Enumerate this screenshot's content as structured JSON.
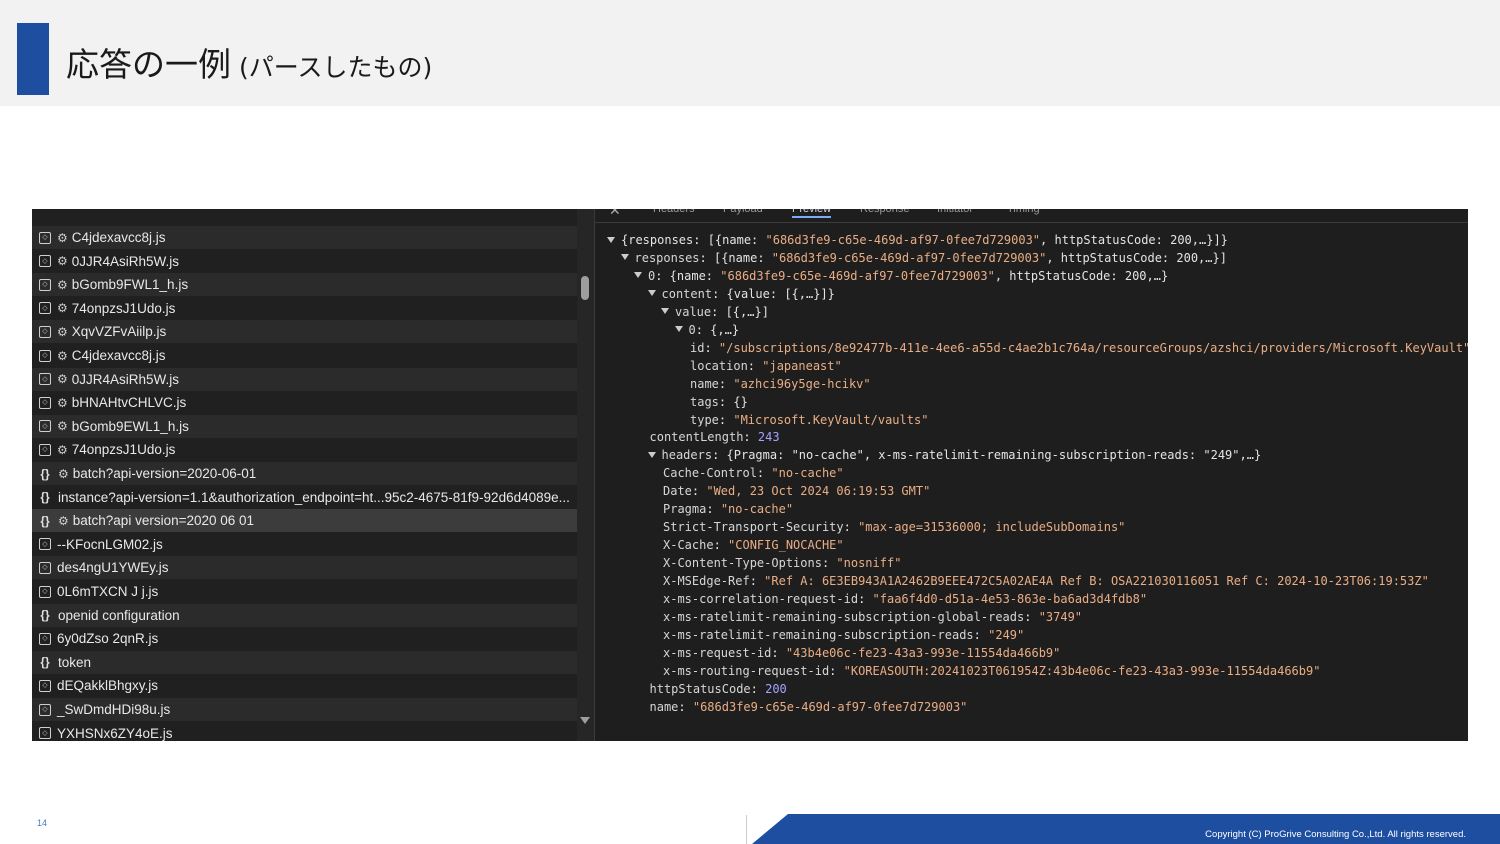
{
  "slide": {
    "title_main": "応答の一例",
    "title_sub": " (パースしたもの)",
    "page_number": "14",
    "copyright": "Copyright (C) ProGrive Consulting Co.,Ltd. All rights reserved."
  },
  "file_list": {
    "items": [
      {
        "name": "C4jdexavcc8j.js",
        "icon": "file-icon",
        "gear": true
      },
      {
        "name": "0JJR4AsiRh5W.js",
        "icon": "file-icon",
        "gear": true
      },
      {
        "name": "bGomb9FWL1_h.js",
        "icon": "file-icon",
        "gear": true
      },
      {
        "name": "74onpzsJ1Udo.js",
        "icon": "file-icon",
        "gear": true
      },
      {
        "name": "XqvVZFvAiilp.js",
        "icon": "file-icon",
        "gear": true
      },
      {
        "name": "C4jdexavcc8j.js",
        "icon": "file-icon",
        "gear": true
      },
      {
        "name": "0JJR4AsiRh5W.js",
        "icon": "file-icon",
        "gear": true
      },
      {
        "name": "bHNAHtvCHLVC.js",
        "icon": "file-icon",
        "gear": true
      },
      {
        "name": "bGomb9EWL1_h.js",
        "icon": "file-icon",
        "gear": true
      },
      {
        "name": "74onpzsJ1Udo.js",
        "icon": "file-icon",
        "gear": true
      },
      {
        "name": "batch?api-version=2020-06-01",
        "icon": "braces-icon",
        "gear": true
      },
      {
        "name": "instance?api-version=1.1&authorization_endpoint=ht...95c2-4675-81f9-92d6d4089e...",
        "icon": "braces-icon",
        "gear": false
      },
      {
        "name": "batch?api version=2020 06 01",
        "icon": "braces-icon",
        "gear": true,
        "selected": true
      },
      {
        "name": "--KFocnLGM02.js",
        "icon": "file-icon",
        "gear": false
      },
      {
        "name": "des4ngU1YWEy.js",
        "icon": "file-icon",
        "gear": false
      },
      {
        "name": "0L6mTXCN J j.js",
        "icon": "file-icon",
        "gear": false
      },
      {
        "name": "openid configuration",
        "icon": "braces-icon",
        "gear": false
      },
      {
        "name": "6y0dZso 2qnR.js",
        "icon": "file-icon",
        "gear": false
      },
      {
        "name": "token",
        "icon": "braces-icon",
        "gear": false
      },
      {
        "name": "dEQakklBhgxy.js",
        "icon": "file-icon",
        "gear": false
      },
      {
        "name": "_SwDmdHDi98u.js",
        "icon": "file-icon",
        "gear": false
      },
      {
        "name": "YXHSNx6ZY4oE.js",
        "icon": "file-icon",
        "gear": false
      }
    ]
  },
  "preview": {
    "tabs": [
      "Headers",
      "Payload",
      "Preview",
      "Response",
      "Initiator",
      "Timing"
    ],
    "active_tab": "Preview",
    "lines": [
      {
        "indent": 0,
        "tri": true,
        "parts": [
          [
            "p",
            "{responses: [{name: "
          ],
          [
            "s",
            "\"686d3fe9-c65e-469d-af97-0fee7d729003\""
          ],
          [
            "p",
            ", httpStatusCode: 200,…}]}"
          ]
        ]
      },
      {
        "indent": 1,
        "tri": true,
        "parts": [
          [
            "k",
            "responses"
          ],
          [
            "p",
            ": [{name: "
          ],
          [
            "s",
            "\"686d3fe9-c65e-469d-af97-0fee7d729003\""
          ],
          [
            "p",
            ", httpStatusCode: 200,…}]"
          ]
        ]
      },
      {
        "indent": 2,
        "tri": true,
        "parts": [
          [
            "k",
            "0"
          ],
          [
            "p",
            ": {name: "
          ],
          [
            "s",
            "\"686d3fe9-c65e-469d-af97-0fee7d729003\""
          ],
          [
            "p",
            ", httpStatusCode: 200,…}"
          ]
        ]
      },
      {
        "indent": 3,
        "tri": true,
        "parts": [
          [
            "k",
            "content"
          ],
          [
            "p",
            ": {value: [{,…}]}"
          ]
        ]
      },
      {
        "indent": 4,
        "tri": true,
        "parts": [
          [
            "k",
            "value"
          ],
          [
            "p",
            ": [{,…}]"
          ]
        ]
      },
      {
        "indent": 5,
        "tri": true,
        "parts": [
          [
            "k",
            "0"
          ],
          [
            "p",
            ": {,…}"
          ]
        ]
      },
      {
        "indent": 6,
        "tri": false,
        "parts": [
          [
            "k",
            "id"
          ],
          [
            "p",
            ": "
          ],
          [
            "s",
            "\"/subscriptions/8e92477b-411e-4ee6-a55d-c4ae2b1c764a/resourceGroups/azshci/providers/Microsoft.KeyVault\""
          ]
        ]
      },
      {
        "indent": 6,
        "tri": false,
        "parts": [
          [
            "k",
            "location"
          ],
          [
            "p",
            ": "
          ],
          [
            "s",
            "\"japaneast\""
          ]
        ]
      },
      {
        "indent": 6,
        "tri": false,
        "parts": [
          [
            "k",
            "name"
          ],
          [
            "p",
            ": "
          ],
          [
            "s",
            "\"azhci96y5ge-hcikv\""
          ]
        ]
      },
      {
        "indent": 6,
        "tri": false,
        "parts": [
          [
            "k",
            "tags"
          ],
          [
            "p",
            ": {}"
          ]
        ]
      },
      {
        "indent": 6,
        "tri": false,
        "parts": [
          [
            "k",
            "type"
          ],
          [
            "p",
            ": "
          ],
          [
            "s",
            "\"Microsoft.KeyVault/vaults\""
          ]
        ]
      },
      {
        "indent": 3,
        "tri": false,
        "parts": [
          [
            "k",
            "contentLength"
          ],
          [
            "p",
            ": "
          ],
          [
            "n",
            "243"
          ]
        ]
      },
      {
        "indent": 3,
        "tri": true,
        "parts": [
          [
            "k",
            "headers"
          ],
          [
            "p",
            ": {Pragma: "
          ],
          [
            "p",
            "\"no-cache\""
          ],
          [
            "p",
            ", x-ms-ratelimit-remaining-subscription-reads: "
          ],
          [
            "p",
            "\"249\""
          ],
          [
            "p",
            ",…}"
          ]
        ]
      },
      {
        "indent": 4,
        "tri": false,
        "parts": [
          [
            "k",
            "Cache-Control"
          ],
          [
            "p",
            ": "
          ],
          [
            "s",
            "\"no-cache\""
          ]
        ]
      },
      {
        "indent": 4,
        "tri": false,
        "parts": [
          [
            "k",
            "Date"
          ],
          [
            "p",
            ": "
          ],
          [
            "s",
            "\"Wed, 23 Oct 2024 06:19:53 GMT\""
          ]
        ]
      },
      {
        "indent": 4,
        "tri": false,
        "parts": [
          [
            "k",
            "Pragma"
          ],
          [
            "p",
            ": "
          ],
          [
            "s",
            "\"no-cache\""
          ]
        ]
      },
      {
        "indent": 4,
        "tri": false,
        "parts": [
          [
            "k",
            "Strict-Transport-Security"
          ],
          [
            "p",
            ": "
          ],
          [
            "s",
            "\"max-age=31536000; includeSubDomains\""
          ]
        ]
      },
      {
        "indent": 4,
        "tri": false,
        "parts": [
          [
            "k",
            "X-Cache"
          ],
          [
            "p",
            ": "
          ],
          [
            "s",
            "\"CONFIG_NOCACHE\""
          ]
        ]
      },
      {
        "indent": 4,
        "tri": false,
        "parts": [
          [
            "k",
            "X-Content-Type-Options"
          ],
          [
            "p",
            ": "
          ],
          [
            "s",
            "\"nosniff\""
          ]
        ]
      },
      {
        "indent": 4,
        "tri": false,
        "parts": [
          [
            "k",
            "X-MSEdge-Ref"
          ],
          [
            "p",
            ": "
          ],
          [
            "s",
            "\"Ref A: 6E3EB943A1A2462B9EEE472C5A02AE4A Ref B: OSA221030116051 Ref C: 2024-10-23T06:19:53Z\""
          ]
        ]
      },
      {
        "indent": 4,
        "tri": false,
        "parts": [
          [
            "k",
            "x-ms-correlation-request-id"
          ],
          [
            "p",
            ": "
          ],
          [
            "s",
            "\"faa6f4d0-d51a-4e53-863e-ba6ad3d4fdb8\""
          ]
        ]
      },
      {
        "indent": 4,
        "tri": false,
        "parts": [
          [
            "k",
            "x-ms-ratelimit-remaining-subscription-global-reads"
          ],
          [
            "p",
            ": "
          ],
          [
            "s",
            "\"3749\""
          ]
        ]
      },
      {
        "indent": 4,
        "tri": false,
        "parts": [
          [
            "k",
            "x-ms-ratelimit-remaining-subscription-reads"
          ],
          [
            "p",
            ": "
          ],
          [
            "s",
            "\"249\""
          ]
        ]
      },
      {
        "indent": 4,
        "tri": false,
        "parts": [
          [
            "k",
            "x-ms-request-id"
          ],
          [
            "p",
            ": "
          ],
          [
            "s",
            "\"43b4e06c-fe23-43a3-993e-11554da466b9\""
          ]
        ]
      },
      {
        "indent": 4,
        "tri": false,
        "parts": [
          [
            "k",
            "x-ms-routing-request-id"
          ],
          [
            "p",
            ": "
          ],
          [
            "s",
            "\"KOREASOUTH:20241023T061954Z:43b4e06c-fe23-43a3-993e-11554da466b9\""
          ]
        ]
      },
      {
        "indent": 3,
        "tri": false,
        "parts": [
          [
            "k",
            "httpStatusCode"
          ],
          [
            "p",
            ": "
          ],
          [
            "n",
            "200"
          ]
        ]
      },
      {
        "indent": 3,
        "tri": false,
        "parts": [
          [
            "k",
            "name"
          ],
          [
            "p",
            ": "
          ],
          [
            "s",
            "\"686d3fe9-c65e-469d-af97-0fee7d729003\""
          ]
        ]
      }
    ]
  },
  "colors": {
    "accent": "#1e4ea0",
    "string": "#e9ad85",
    "number": "#a5a2ff",
    "panel_bg": "#1e1e1e"
  }
}
